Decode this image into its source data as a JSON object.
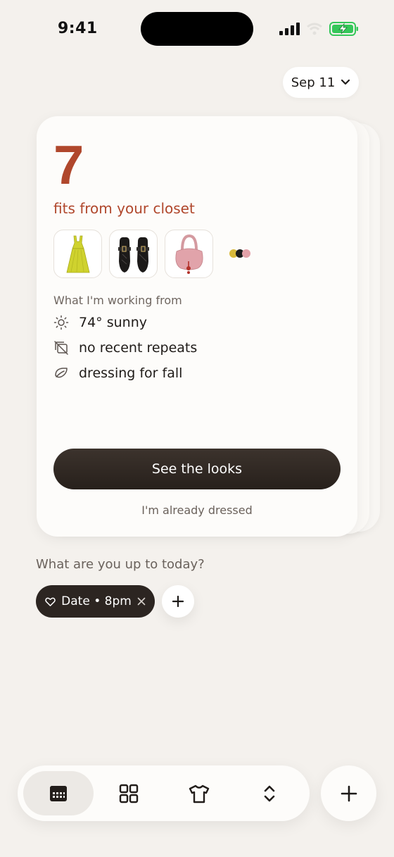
{
  "status_bar": {
    "time": "9:41"
  },
  "date_selector": {
    "label": "Sep 11"
  },
  "card": {
    "count": "7",
    "subtitle": "fits from your closet",
    "thumbnails": [
      "yellow-dress-icon",
      "black-mary-jane-shoes-icon",
      "pink-handbag-icon"
    ],
    "swatches": [
      "#d9b93a",
      "#1c1c1c",
      "#e3a1a8"
    ],
    "section_label": "What I'm working from",
    "reasons": [
      {
        "icon": "sun-icon",
        "text": "74° sunny"
      },
      {
        "icon": "no-repeat-icon",
        "text": "no recent repeats"
      },
      {
        "icon": "leaf-icon",
        "text": "dressing for fall"
      }
    ],
    "primary_button": "See the looks",
    "secondary_link": "I'm already dressed"
  },
  "plans": {
    "question": "What are you up to today?",
    "chip": {
      "icon": "heart-icon",
      "label": "Date • 8pm"
    }
  },
  "tab_bar": {
    "tabs": [
      {
        "icon": "calendar-icon",
        "active": true
      },
      {
        "icon": "grid-icon",
        "active": false
      },
      {
        "icon": "tshirt-icon",
        "active": false
      },
      {
        "icon": "chevrons-updown-icon",
        "active": false
      }
    ],
    "add_icon": "plus-icon"
  },
  "colors": {
    "accent": "#b0472c",
    "background": "#f4f1ed",
    "button_dark": "#2c2521",
    "battery_green": "#35c759"
  }
}
